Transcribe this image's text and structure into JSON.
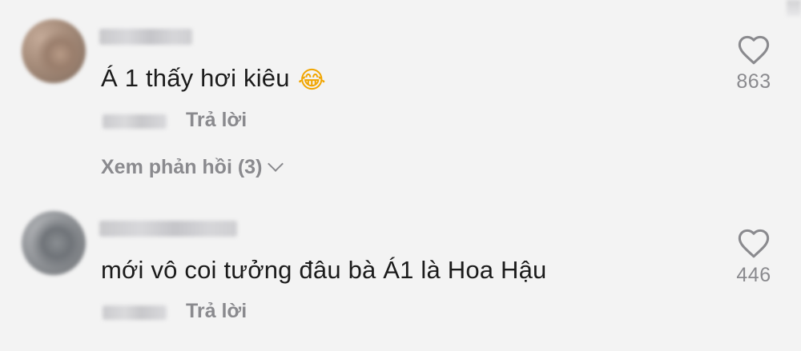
{
  "comments": [
    {
      "text": "Á 1 thấy hơi kiêu",
      "emoji": "😂",
      "reply_label": "Trả lời",
      "view_replies_label": "Xem phản hồi (3)",
      "likes": "863"
    },
    {
      "text": "mới vô coi tưởng đâu bà Á1 là Hoa Hậu",
      "reply_label": "Trả lời",
      "likes": "446"
    }
  ],
  "icons": {
    "like": "heart-outline-icon",
    "expand": "chevron-down-icon"
  },
  "colors": {
    "background": "#f3f3f3",
    "text": "#1b1b1b",
    "muted": "#8a8a8e"
  }
}
